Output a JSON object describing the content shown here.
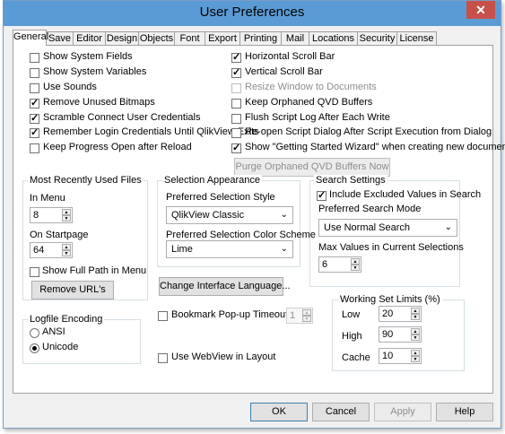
{
  "window": {
    "title": "User Preferences",
    "close_glyph": "✕"
  },
  "tabs": [
    "General",
    "Save",
    "Editor",
    "Design",
    "Objects",
    "Font",
    "Export",
    "Printing",
    "Mail",
    "Locations",
    "Security",
    "License"
  ],
  "left_checks": [
    {
      "label": "Show System Fields",
      "checked": false
    },
    {
      "label": "Show System Variables",
      "checked": false
    },
    {
      "label": "Use Sounds",
      "checked": false
    },
    {
      "label": "Remove Unused Bitmaps",
      "checked": true
    },
    {
      "label": "Scramble Connect User Credentials",
      "checked": true
    },
    {
      "label": "Remember Login Credentials Until QlikView Exits",
      "checked": true
    },
    {
      "label": "Keep Progress Open after Reload",
      "checked": false
    }
  ],
  "right_checks": [
    {
      "label": "Horizontal Scroll Bar",
      "checked": true
    },
    {
      "label": "Vertical Scroll Bar",
      "checked": true
    },
    {
      "label": "Resize Window to Documents",
      "checked": false,
      "disabled": true
    },
    {
      "label": "Keep Orphaned QVD Buffers",
      "checked": false
    },
    {
      "label": "Flush Script Log After Each Write",
      "checked": false
    },
    {
      "label": "Re-open Script Dialog After Script Execution from Dialog",
      "checked": false
    },
    {
      "label": "Show \"Getting Started Wizard\" when creating new document",
      "checked": true
    }
  ],
  "purge_button": "Purge Orphaned QVD Buffers Now",
  "mru": {
    "title": "Most Recently Used Files",
    "in_menu_label": "In Menu",
    "in_menu_value": "8",
    "on_startpage_label": "On Startpage",
    "on_startpage_value": "64",
    "show_full_path_label": "Show Full Path in Menu",
    "remove_button": "Remove URL's"
  },
  "selection": {
    "title": "Selection Appearance",
    "style_label": "Preferred Selection Style",
    "style_value": "QlikView Classic",
    "color_label": "Preferred Selection Color Scheme",
    "color_value": "Lime"
  },
  "change_language_button": "Change Interface Language...",
  "search": {
    "title": "Search Settings",
    "include_excluded_label": "Include Excluded Values in Search",
    "mode_label": "Preferred Search Mode",
    "mode_value": "Use Normal Search",
    "max_values_label": "Max Values in Current Selections",
    "max_values_value": "6"
  },
  "logfile": {
    "title": "Logfile Encoding",
    "ansi": "ANSI",
    "unicode": "Unicode"
  },
  "bookmark": {
    "label": "Bookmark Pop-up Timeout (s)",
    "value": "1"
  },
  "webview_label": "Use WebView in Layout",
  "working_set": {
    "title": "Working Set Limits (%)",
    "low_label": "Low",
    "low_value": "20",
    "high_label": "High",
    "high_value": "90",
    "cache_label": "Cache",
    "cache_value": "10"
  },
  "buttons": {
    "ok": "OK",
    "cancel": "Cancel",
    "apply": "Apply",
    "help": "Help"
  },
  "icons": {
    "spin_up": "▲",
    "spin_down": "▼",
    "dropdown": "⌄"
  }
}
